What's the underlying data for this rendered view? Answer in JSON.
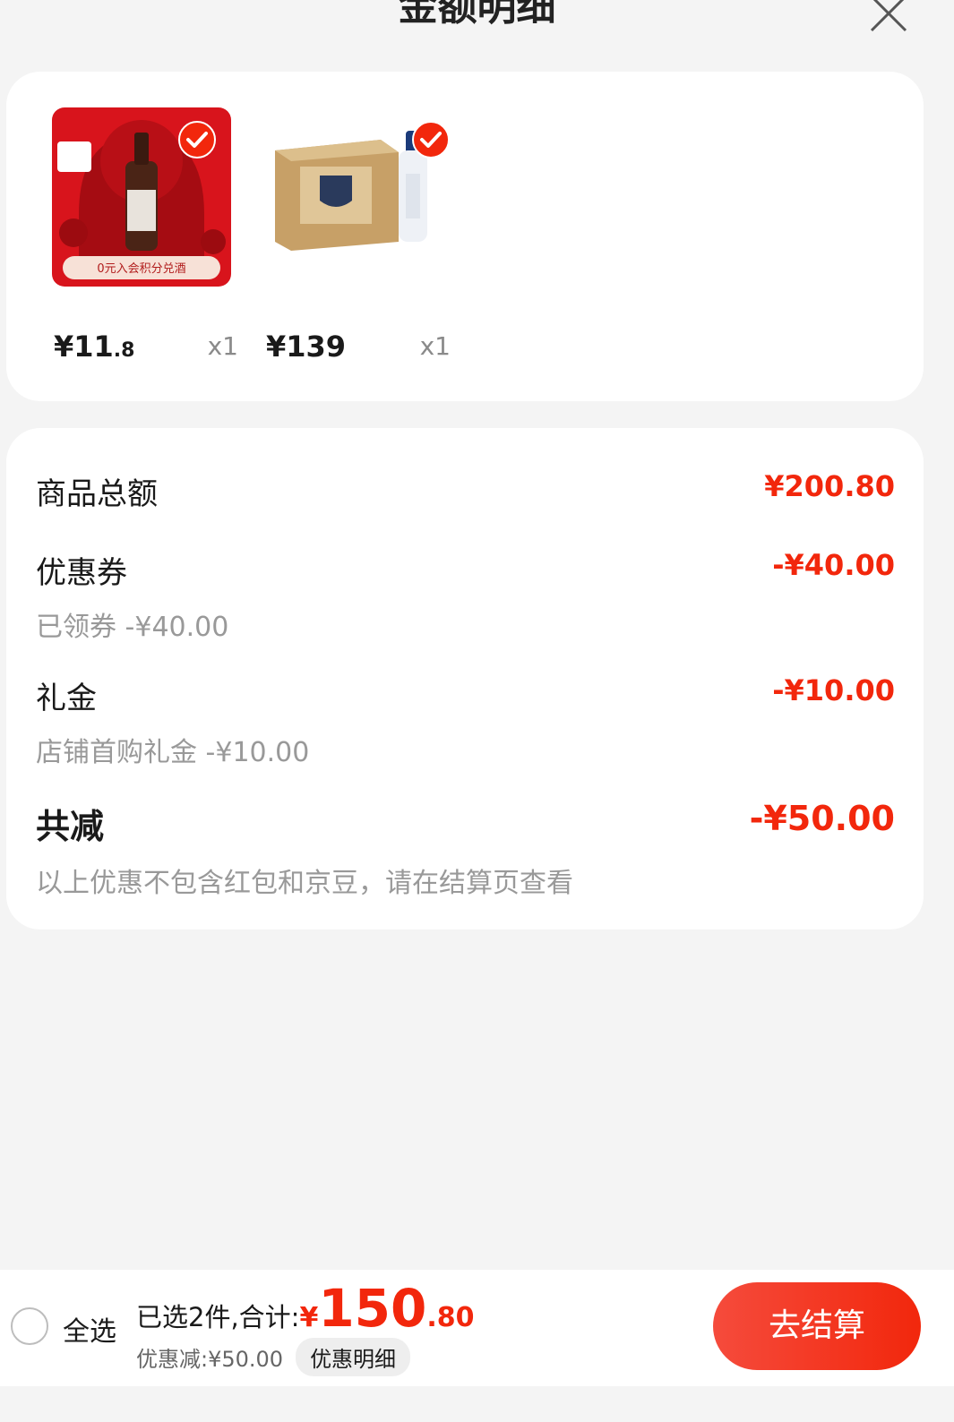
{
  "header": {
    "title": "金额明细",
    "close_icon": "close-icon"
  },
  "products": [
    {
      "price_main": "¥11",
      "price_decimal": ".8",
      "qty": "x1",
      "badge_text": "0元入会积分兑酒",
      "selected": true
    },
    {
      "price_main": "¥139",
      "price_decimal": "",
      "qty": "x1",
      "selected": true
    }
  ],
  "summary": {
    "subtotal_label": "商品总额",
    "subtotal_amount": "¥200.80",
    "coupon_label": "优惠券",
    "coupon_sub": "已领券 -¥40.00",
    "coupon_amount": "-¥40.00",
    "gift_label": "礼金",
    "gift_sub": "店铺首购礼金 -¥10.00",
    "gift_amount": "-¥10.00",
    "total_label": "共减",
    "total_amount": "-¥50.00",
    "total_note": "以上优惠不包含红包和京豆，请在结算页查看"
  },
  "bottom": {
    "select_all": "全选",
    "selected_text": "已选2件,合计:",
    "total_symbol": "¥",
    "total_int": "150",
    "total_dec": ".80",
    "discount_text": "优惠减:¥50.00",
    "discount_detail": "优惠明细",
    "checkout": "去结算"
  },
  "colors": {
    "accent": "#f2270c",
    "background": "#f4f4f4"
  }
}
